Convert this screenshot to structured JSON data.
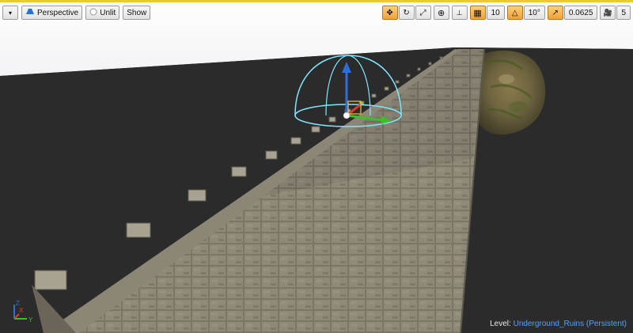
{
  "toolbar": {
    "menu_icon": "dropdown-arrow-icon",
    "perspective_label": "Perspective",
    "unlit_label": "Unlit",
    "show_label": "Show",
    "grid_snap_value": "10",
    "rotation_snap_value": "10°",
    "scale_snap_value": "0.0625",
    "camera_speed_value": "5"
  },
  "status": {
    "level_prefix": "Level:",
    "level_name": "Underground_Ruins (Persistent)"
  },
  "axes": {
    "x_label": "X",
    "y_label": "Y",
    "z_label": "Z"
  },
  "colors": {
    "accent": "#f3c63a",
    "orange_button": "#f0a23a",
    "gizmo_x": "#e23b2a",
    "gizmo_y": "#3fbf25",
    "gizmo_z": "#2a6fe0",
    "gizmo_circle": "#7fe6ff",
    "level_text": "#4fa3ff"
  }
}
